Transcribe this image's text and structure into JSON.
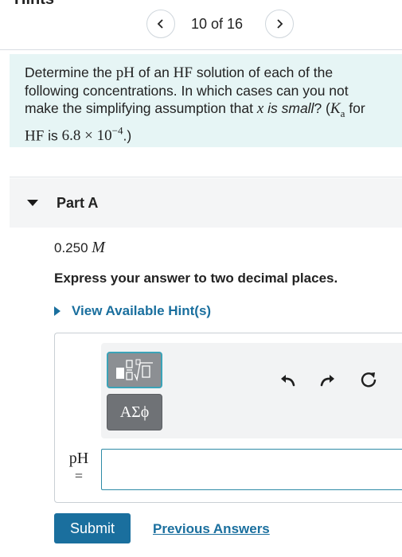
{
  "header_cut": "Hints",
  "pager": {
    "text": "10 of 16"
  },
  "problem": {
    "line1_a": "Determine the ",
    "pH": "pH",
    "line1_b": " of an ",
    "HF": "HF",
    "line1_c": " solution of each of the",
    "line2": "following concentrations. In which cases can you not",
    "line3_a": "make the simplifying assumption that ",
    "x": "x",
    "line3_b": " is small",
    "line3_c": "? (",
    "K": "K",
    "Ka_sub": "a",
    "line3_d": " for",
    "HF2": "HF",
    "line4_a": " is ",
    "ka_val": "6.8 × 10",
    "ka_exp": "−4",
    "line4_b": ".)"
  },
  "part": {
    "title": "Part A"
  },
  "concentration": {
    "value": "0.250",
    "unit": "M"
  },
  "instruction": "Express your answer to two decimal places.",
  "hint_link": "View Available Hint(s)",
  "toolbar": {
    "greek_label": "ΑΣϕ"
  },
  "answer": {
    "label": "pH",
    "equals": "=",
    "value": ""
  },
  "buttons": {
    "submit": "Submit",
    "previous_answers": "Previous Answers"
  },
  "colors": {
    "accent": "#1a6f9e",
    "problem_bg": "#e6f5f5",
    "input_border": "#2e8ba6"
  },
  "icons": [
    "chevron-left-icon",
    "chevron-right-icon",
    "caret-down-icon",
    "caret-right-icon",
    "template-icon",
    "undo-icon",
    "redo-icon",
    "reset-icon"
  ]
}
